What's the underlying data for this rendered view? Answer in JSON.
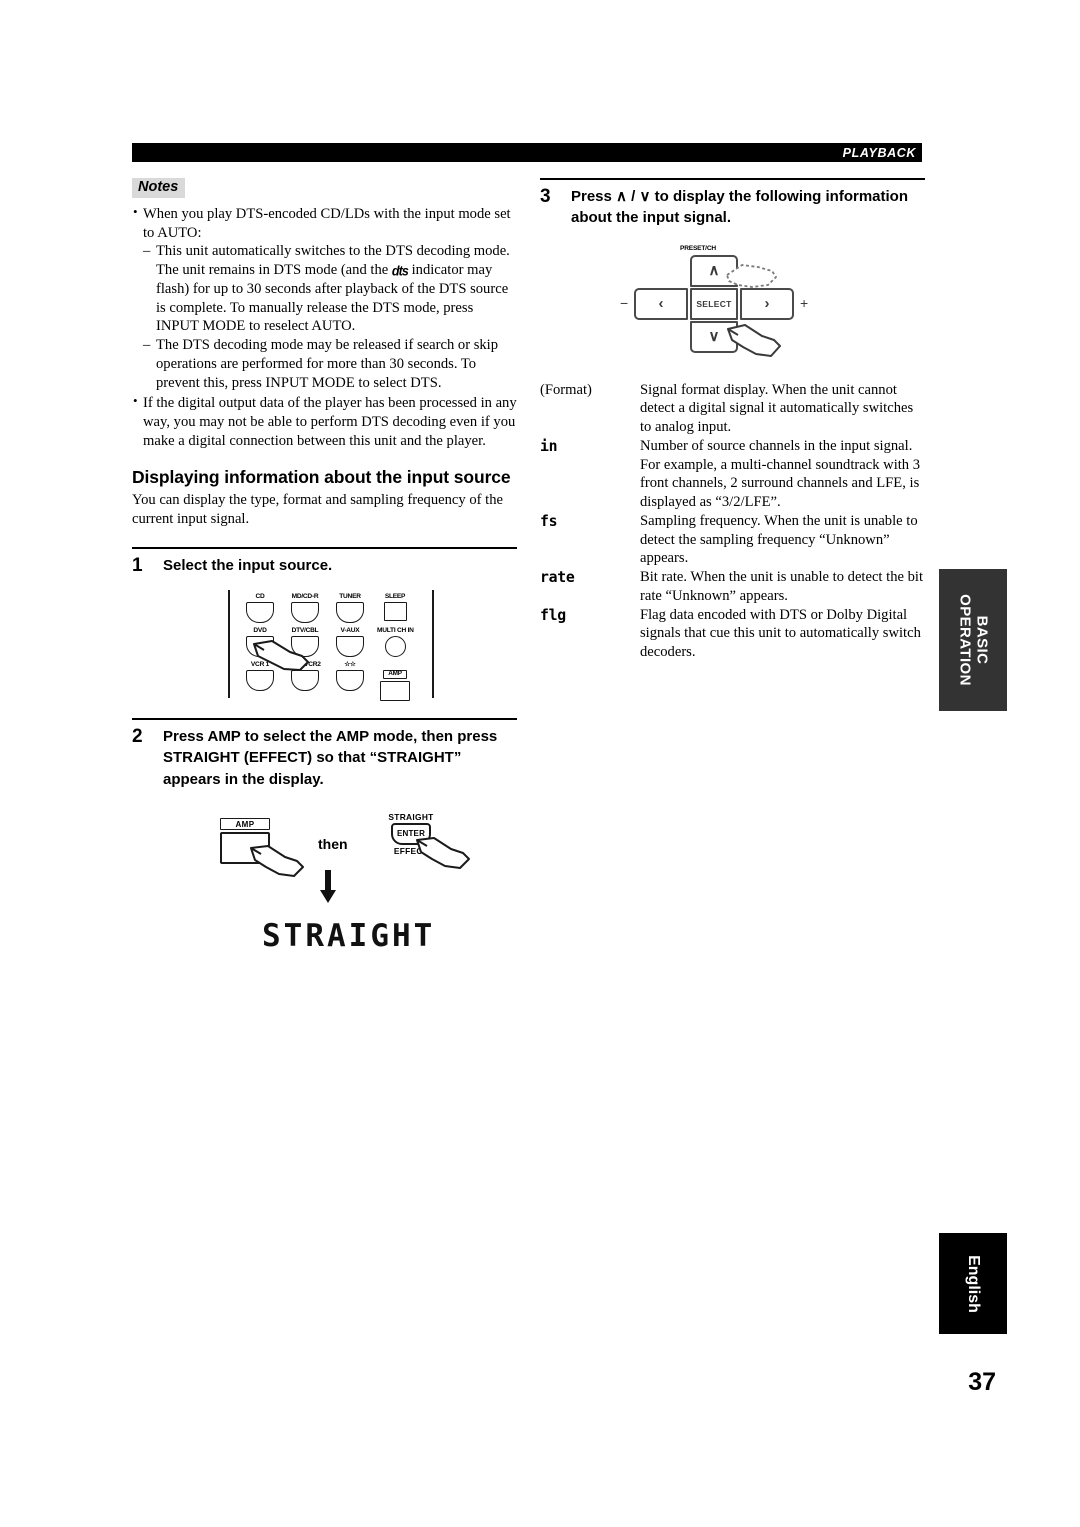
{
  "header": {
    "section_label": "PLAYBACK"
  },
  "left_column": {
    "notes": {
      "title": "Notes",
      "items": [
        {
          "text": "When you play DTS-encoded CD/LDs with the input mode set to AUTO:",
          "sub_items": [
            "This unit automatically switches to the DTS decoding mode. The unit remains in DTS mode (and the ■ indicator may flash) for up to 30 seconds after playback of the DTS source is complete. To manually release the DTS mode, press INPUT MODE to reselect AUTO.",
            "The DTS decoding mode may be released if search or skip operations are performed for more than 30 seconds. To prevent this, press INPUT MODE to select DTS."
          ]
        },
        {
          "text": "If the digital output data of the player has been processed in any way, you may not be able to perform DTS decoding even if you make a digital connection between this unit and the player.",
          "sub_items": []
        }
      ],
      "dts_logo_text": "dts",
      "sub_item_1_part_a": "This unit automatically switches to the DTS decoding mode. The unit remains in DTS mode (and the",
      "sub_item_1_part_b": "indicator may flash) for up to 30 seconds after playback of the DTS source is complete. To manually release the DTS mode, press INPUT MODE to reselect AUTO."
    },
    "section_heading": "Displaying information about the input source",
    "section_intro": "You can display the type, format and sampling frequency of the current input signal.",
    "step1": {
      "number": "1",
      "text": "Select the input source."
    },
    "keypad": {
      "rows": [
        [
          {
            "label": "CD",
            "shape": "round"
          },
          {
            "label": "MD/CD-R",
            "shape": "round"
          },
          {
            "label": "TUNER",
            "shape": "round"
          },
          {
            "label": "SLEEP",
            "shape": "square"
          }
        ],
        [
          {
            "label": "DVD",
            "shape": "round"
          },
          {
            "label": "DTV/CBL",
            "shape": "round"
          },
          {
            "label": "V-AUX",
            "shape": "round"
          },
          {
            "label": "MULTI CH IN",
            "shape": "circle"
          }
        ],
        [
          {
            "label": "VCR 1",
            "shape": "round"
          },
          {
            "label": "DVR/VCR2",
            "shape": "round"
          },
          {
            "label": "☆☆",
            "shape": "round"
          },
          {
            "label": "AMP",
            "shape": "amp"
          }
        ]
      ]
    },
    "step2": {
      "number": "2",
      "text": "Press AMP to select the AMP mode, then press STRAIGHT (EFFECT) so that “STRAIGHT” appears in the display."
    },
    "amp_figure": {
      "amp_cap": "AMP",
      "then_label": "then",
      "straight_label": "STRAIGHT",
      "enter_label": "ENTER",
      "effect_label": "EFFECT"
    },
    "lcd_readout": "STRAIGHT"
  },
  "right_column": {
    "step3": {
      "number": "3",
      "text_before": "Press",
      "up_glyph": "∧",
      "slash": "/",
      "down_glyph": "∨",
      "text_after": "to display the following information about the input signal.",
      "full_text": "Press ∧ / ∨ to display the following information about the input signal."
    },
    "cursor_pad": {
      "preset_label": "PRESET/CH",
      "up": "∧",
      "down": "∨",
      "left": "‹",
      "right": "›",
      "select": "SELECT",
      "minus": "−",
      "plus": "+"
    },
    "definitions": [
      {
        "term": "(Format)",
        "style": "normal",
        "description": "Signal format display. When the unit cannot detect a digital signal it automatically switches to analog input."
      },
      {
        "term": "in",
        "style": "lcd",
        "description": "Number of source channels in the input signal. For example, a multi-channel soundtrack with 3 front channels, 2 surround channels and LFE, is displayed as “3/2/LFE”."
      },
      {
        "term": "fs",
        "style": "lcd",
        "description": "Sampling frequency. When the unit is unable to detect the sampling frequency “Unknown” appears."
      },
      {
        "term": "rate",
        "style": "lcd",
        "description": "Bit rate. When the unit is unable to detect the bit rate “Unknown” appears."
      },
      {
        "term": "flg",
        "style": "lcd",
        "description": "Flag data encoded with DTS or Dolby Digital signals that cue this unit to automatically switch decoders."
      }
    ]
  },
  "side_tabs": {
    "basic_operation": "BASIC\nOPERATION",
    "basic_operation_line1": "BASIC",
    "basic_operation_line2": "OPERATION",
    "english": "English"
  },
  "page_number": "37"
}
